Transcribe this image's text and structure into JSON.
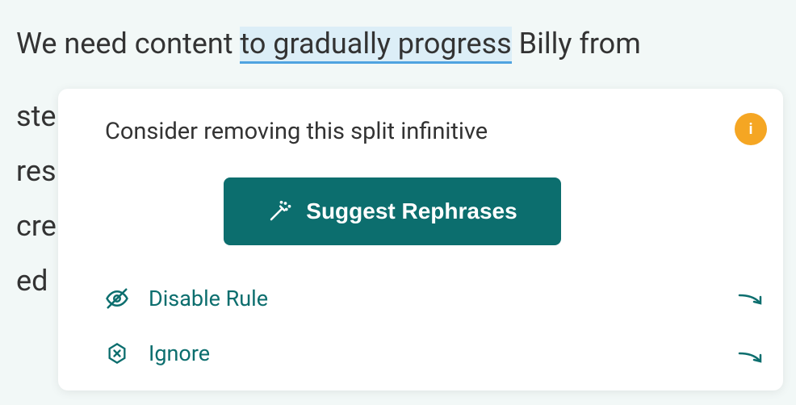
{
  "document": {
    "line1_pre": "We need content ",
    "line1_highlight": "to gradually progress",
    "line1_post": " Billy from",
    "bg_rows": [
      "ste",
      "res",
      "cre",
      "ed"
    ]
  },
  "popup": {
    "title": "Consider removing this split infinitive",
    "suggest_button": "Suggest Rephrases",
    "actions": {
      "disable": "Disable Rule",
      "ignore": "Ignore"
    },
    "info_glyph": "i"
  }
}
